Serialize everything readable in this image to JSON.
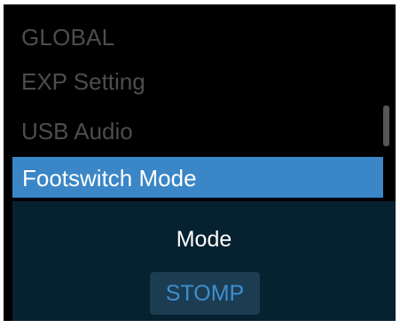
{
  "header": {
    "title": "GLOBAL"
  },
  "menu": {
    "items": [
      {
        "label": "EXP Setting"
      },
      {
        "label": "USB Audio"
      },
      {
        "label": "Footswitch Mode"
      }
    ],
    "selected_index": 2
  },
  "submenu": {
    "label": "Mode",
    "value": "STOMP"
  },
  "colors": {
    "selection": "#3a86c6",
    "panel": "#06212f",
    "value_button": "#1c3c52",
    "value_text": "#3d8fd0",
    "inactive_text": "#4d4d4d"
  }
}
